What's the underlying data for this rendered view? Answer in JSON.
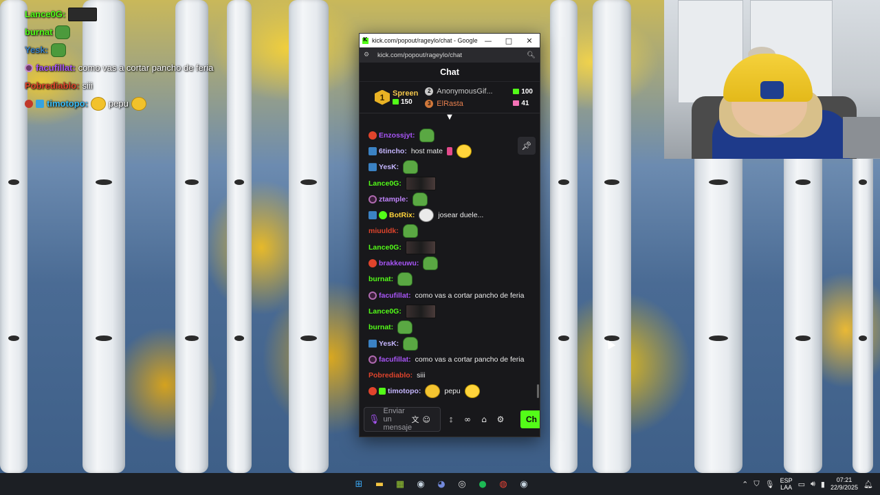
{
  "overlay_chat": [
    {
      "user": "Lance0G:",
      "color": "#53fc18",
      "text": "",
      "emote": "dark"
    },
    {
      "user": "burnat",
      "color": "#53fc18",
      "text": "",
      "emote": "pepe"
    },
    {
      "user": "Yesk:",
      "color": "#3b82c4",
      "text": "",
      "emote": "pepe"
    },
    {
      "user": "facufillat:",
      "color": "#a855f7",
      "text": "como vas a cortar pancho de feria",
      "emote": ""
    },
    {
      "user": "Pobrediablo:",
      "color": "#e0442c",
      "text": "siii",
      "emote": ""
    },
    {
      "user": "timotopo:",
      "color": "#38bdf8",
      "text": "pepu",
      "emote": "duck"
    }
  ],
  "window": {
    "title": "kick.com/popout/rageylo/chat - Google C...",
    "minimize": "—",
    "maximize": "□",
    "close": "✕",
    "url": "kick.com/popout/rageylo/chat"
  },
  "chat": {
    "header": "Chat",
    "leaderboard": {
      "first": {
        "rank": "1",
        "name": "Spreen",
        "count": "150"
      },
      "second": {
        "rank": "2",
        "name": "AnonymousGif...",
        "count": "100"
      },
      "third": {
        "rank": "3",
        "name": "ElRasta",
        "count": "41"
      }
    },
    "messages": [
      {
        "badge": "red",
        "user": "Enzossjyt:",
        "color": "#a855f7",
        "text": "",
        "emote": "pepe"
      },
      {
        "badge": "vip",
        "user": "6tincho:",
        "color": "#c4b5fd",
        "text": "host mate",
        "emote": "yellow"
      },
      {
        "badge": "vip",
        "user": "YesK:",
        "color": "#c4b5fd",
        "text": "",
        "emote": "pepe"
      },
      {
        "badge": "",
        "user": "Lance0G:",
        "color": "#53fc18",
        "text": "",
        "emote": "dark"
      },
      {
        "badge": "ring",
        "user": "ztample:",
        "color": "#c084fc",
        "text": "",
        "emote": "pepe"
      },
      {
        "badge": "vip",
        "user": "BotRix:",
        "color": "#ffd43b",
        "text": "josear duele...",
        "emote": "face"
      },
      {
        "badge": "",
        "user": "miuuldk:",
        "color": "#e0442c",
        "text": "",
        "emote": "pepe"
      },
      {
        "badge": "",
        "user": "Lance0G:",
        "color": "#53fc18",
        "text": "",
        "emote": "dark"
      },
      {
        "badge": "red",
        "user": "brakkeuwu:",
        "color": "#a855f7",
        "text": "",
        "emote": "pepe"
      },
      {
        "badge": "",
        "user": "burnat:",
        "color": "#53fc18",
        "text": "",
        "emote": "pepe"
      },
      {
        "badge": "ring",
        "user": "facufillat:",
        "color": "#a855f7",
        "text": "como vas a cortar pancho de feria",
        "emote": ""
      },
      {
        "badge": "",
        "user": "Lance0G:",
        "color": "#53fc18",
        "text": "",
        "emote": "dark"
      },
      {
        "badge": "",
        "user": "burnat:",
        "color": "#53fc18",
        "text": "",
        "emote": "pepe"
      },
      {
        "badge": "vip",
        "user": "YesK:",
        "color": "#c4b5fd",
        "text": "",
        "emote": "pepe"
      },
      {
        "badge": "ring",
        "user": "facufillat:",
        "color": "#a855f7",
        "text": "como vas a cortar pancho de feria",
        "emote": ""
      },
      {
        "badge": "",
        "user": "Pobrediablo:",
        "color": "#e0442c",
        "text": "siii",
        "emote": ""
      },
      {
        "badge": "red",
        "user": "timotopo:",
        "color": "#c4b5fd",
        "text": "pepu",
        "emote": "duck"
      }
    ],
    "composer": {
      "placeholder": "Enviar un mensaje",
      "send_label": "Ch"
    }
  },
  "taskbar": {
    "language": "ESP",
    "layout": "LAA",
    "time": "07:21",
    "date": "22/9/2025"
  },
  "colors": {
    "kick_green": "#53fc18",
    "chat_bg": "#18181b",
    "taskbar_bg": "#1c1f24"
  }
}
